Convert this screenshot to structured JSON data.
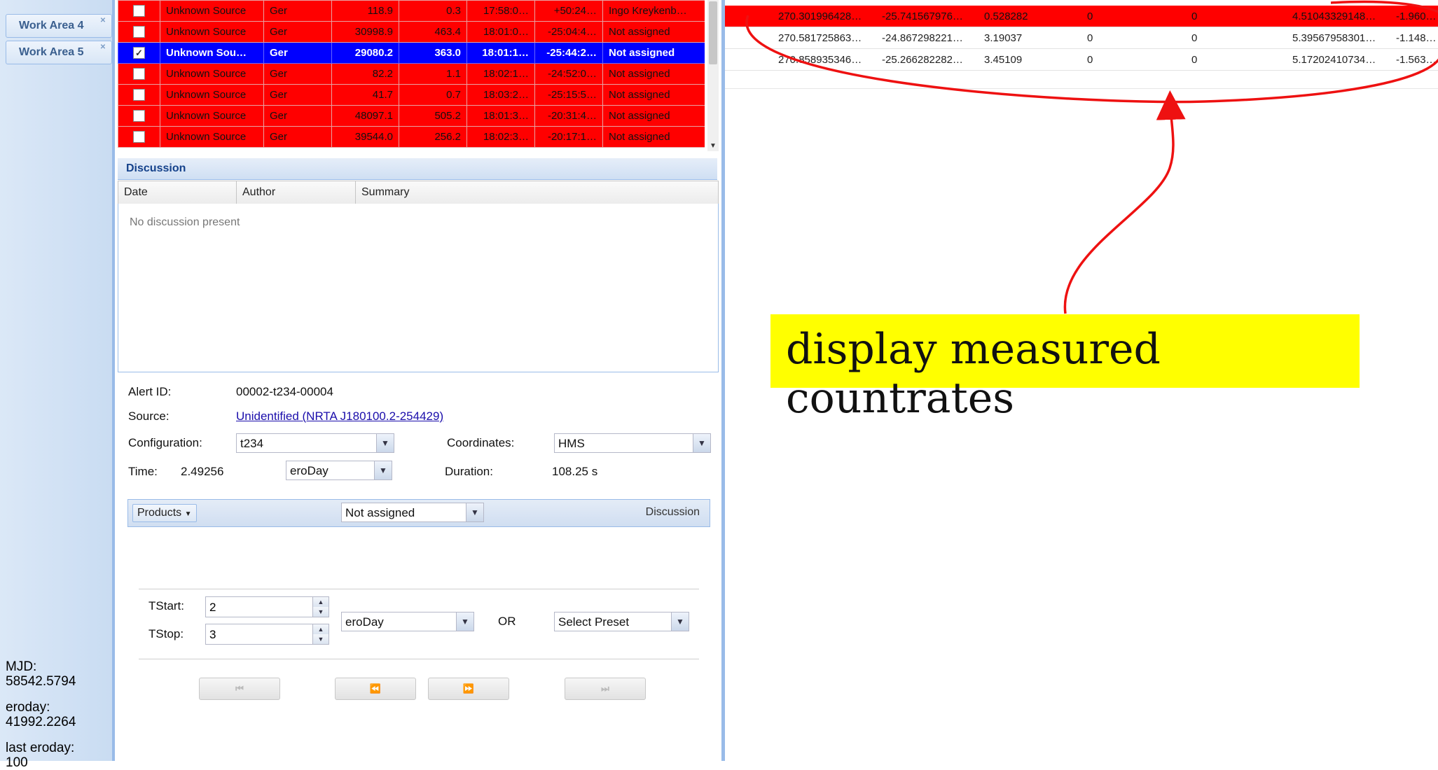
{
  "sidebar": {
    "tabs": [
      {
        "label": "Work Area 4"
      },
      {
        "label": "Work Area 5"
      }
    ],
    "info": {
      "mjd_label": "MJD:",
      "mjd_value": "58542.5794",
      "eroday_label": "eroday:",
      "eroday_value": "41992.2264",
      "last_eroday_label": "last eroday:",
      "last_eroday_value": "100"
    }
  },
  "alerts": [
    {
      "source": "Unknown Source",
      "author": "Ger",
      "counts": "118.9",
      "rate": "0.3",
      "ra": "17:58:0…",
      "dec": "+50:24…",
      "status": "Ingo Kreykenb…",
      "checked": false,
      "selected": false
    },
    {
      "source": "Unknown Source",
      "author": "Ger",
      "counts": "30998.9",
      "rate": "463.4",
      "ra": "18:01:0…",
      "dec": "-25:04:4…",
      "status": "Not assigned",
      "checked": false,
      "selected": false
    },
    {
      "source": "Unknown Sou…",
      "author": "Ger",
      "counts": "29080.2",
      "rate": "363.0",
      "ra": "18:01:1…",
      "dec": "-25:44:2…",
      "status": "Not assigned",
      "checked": true,
      "selected": true
    },
    {
      "source": "Unknown Source",
      "author": "Ger",
      "counts": "82.2",
      "rate": "1.1",
      "ra": "18:02:1…",
      "dec": "-24:52:0…",
      "status": "Not assigned",
      "checked": false,
      "selected": false
    },
    {
      "source": "Unknown Source",
      "author": "Ger",
      "counts": "41.7",
      "rate": "0.7",
      "ra": "18:03:2…",
      "dec": "-25:15:5…",
      "status": "Not assigned",
      "checked": false,
      "selected": false
    },
    {
      "source": "Unknown Source",
      "author": "Ger",
      "counts": "48097.1",
      "rate": "505.2",
      "ra": "18:01:3…",
      "dec": "-20:31:4…",
      "status": "Not assigned",
      "checked": false,
      "selected": false
    },
    {
      "source": "Unknown Source",
      "author": "Ger",
      "counts": "39544.0",
      "rate": "256.2",
      "ra": "18:02:3…",
      "dec": "-20:17:1…",
      "status": "Not assigned",
      "checked": false,
      "selected": false
    }
  ],
  "discussion": {
    "title": "Discussion",
    "columns": [
      "Date",
      "Author",
      "Summary"
    ],
    "empty_text": "No discussion present"
  },
  "form": {
    "alert_id_label": "Alert ID:",
    "alert_id": "00002-t234-00004",
    "source_label": "Source:",
    "source_link": "Unidentified  (NRTA J180100.2-254429)",
    "configuration_label": "Configuration:",
    "configuration_value": "t234",
    "coordinates_label": "Coordinates:",
    "coordinates_value": "HMS",
    "time_label": "Time:",
    "time_value": "2.49256",
    "time_unit": "eroDay",
    "duration_label": "Duration:",
    "duration_value": "108.25 s"
  },
  "toolbar": {
    "products_label": "Products",
    "assign_value": "Not assigned",
    "discussion_label": "Discussion"
  },
  "range": {
    "tstart_label": "TStart:",
    "tstart_value": "2",
    "tstop_label": "TStop:",
    "tstop_value": "3",
    "unit_value": "eroDay",
    "or_label": "OR",
    "preset_value": "Select Preset"
  },
  "nav": {
    "first": "⏮",
    "prev": "⏪",
    "next": "⏩",
    "last": "⏭"
  },
  "rates": [
    {
      "c1": "270.301996428…",
      "c2": "-25.741567976…",
      "c3": "0.528282",
      "c4": "0",
      "c5": "0",
      "c6": "4.51043329148…",
      "c7": "-1.960…",
      "highlight": true
    },
    {
      "c1": "270.581725863…",
      "c2": "-24.867298221…",
      "c3": "3.19037",
      "c4": "0",
      "c5": "0",
      "c6": "5.39567958301…",
      "c7": "-1.148…",
      "highlight": false
    },
    {
      "c1": "270.858935346…",
      "c2": "-25.266282282…",
      "c3": "3.45109",
      "c4": "0",
      "c5": "0",
      "c6": "5.17202410734…",
      "c7": "-1.563…",
      "highlight": false
    }
  ],
  "annotation": {
    "callout_text": "display measured countrates",
    "callout_bg": "#ffff00",
    "ink_color": "#ee1111"
  },
  "colors": {
    "alert_row": "#ff0000",
    "selected_row": "#0000ff",
    "panel_border": "#99bbe8"
  }
}
